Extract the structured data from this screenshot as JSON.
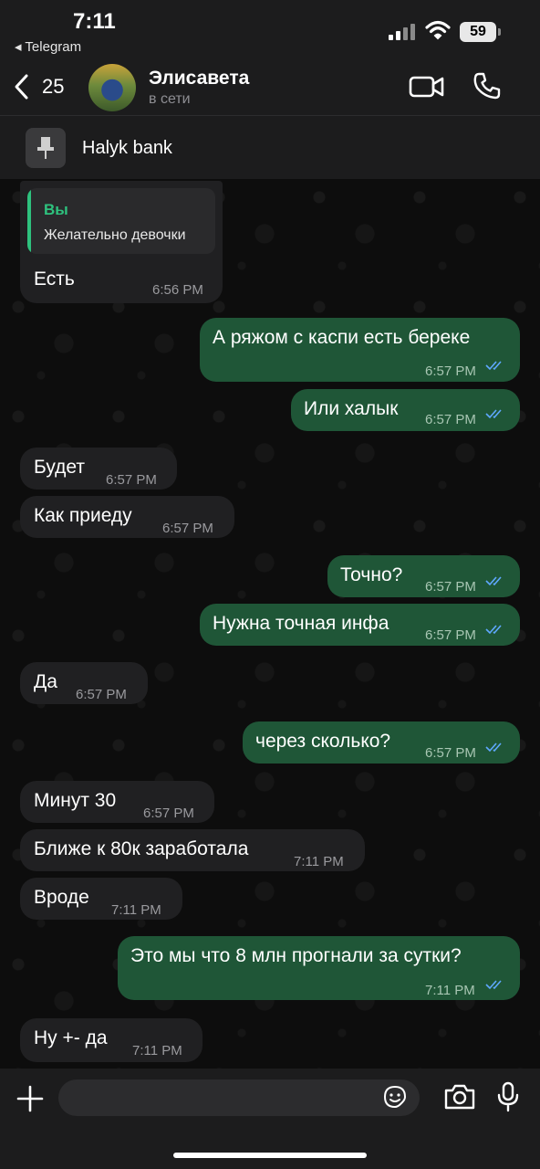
{
  "status_bar": {
    "time": "7:11",
    "back_app": "◂ Telegram",
    "battery": "59"
  },
  "header": {
    "back_count": "25",
    "contact_name": "Элисавета",
    "contact_status": "в сети"
  },
  "pinned": {
    "text": "Halyk bank"
  },
  "messages": [
    {
      "dir": "in",
      "reply_name": "Вы",
      "reply_text": "Желательно девочки",
      "text": "Есть",
      "time": "6:56 PM"
    },
    {
      "dir": "out",
      "text": "А ряжом с каспи есть береке",
      "time": "6:57 PM"
    },
    {
      "dir": "out",
      "text": "Или халык",
      "time": "6:57 PM"
    },
    {
      "dir": "in",
      "text": "Будет",
      "time": "6:57 PM"
    },
    {
      "dir": "in",
      "text": "Как приеду",
      "time": "6:57 PM"
    },
    {
      "dir": "out",
      "text": "Точно?",
      "time": "6:57 PM"
    },
    {
      "dir": "out",
      "text": "Нужна точная инфа",
      "time": "6:57 PM"
    },
    {
      "dir": "in",
      "text": "Да",
      "time": "6:57 PM"
    },
    {
      "dir": "out",
      "text": "через сколько?",
      "time": "6:57 PM"
    },
    {
      "dir": "in",
      "text": "Минут 30",
      "time": "6:57 PM"
    },
    {
      "dir": "in",
      "text": "Ближе к 80к заработала",
      "time": "7:11 PM"
    },
    {
      "dir": "in",
      "text": "Вроде",
      "time": "7:11 PM"
    },
    {
      "dir": "out",
      "text": "Это мы что 8 млн прогнали за сутки?",
      "time": "7:11 PM"
    },
    {
      "dir": "in",
      "text": "Ну +- да",
      "time": "7:11 PM"
    }
  ],
  "input": {
    "placeholder": ""
  },
  "colors": {
    "outgoing": "#1f5637",
    "incoming": "#202022",
    "accent": "#2ec27e",
    "read_ticks": "#5fa8ff"
  }
}
